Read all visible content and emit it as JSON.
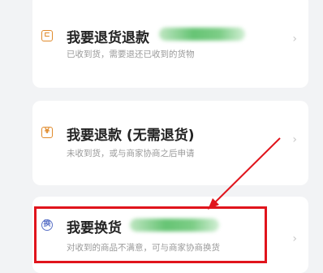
{
  "options": [
    {
      "title": "我要退货退款",
      "subtitle": "已收到货，需要退还已收到的货物",
      "icon": "return-box-icon"
    },
    {
      "title": "我要退款 (无需退货)",
      "subtitle": "未收到货，或与商家协商之后申请",
      "icon": "refund-receipt-icon"
    },
    {
      "title": "我要换货",
      "subtitle": "对收到的商品不满意，可与商家协商换货",
      "icon": "exchange-icon"
    }
  ],
  "chevron": "›",
  "colors": {
    "highlight": "#e0141c",
    "icon_orange": "#e08a2b",
    "icon_blue": "#5b72c7"
  }
}
